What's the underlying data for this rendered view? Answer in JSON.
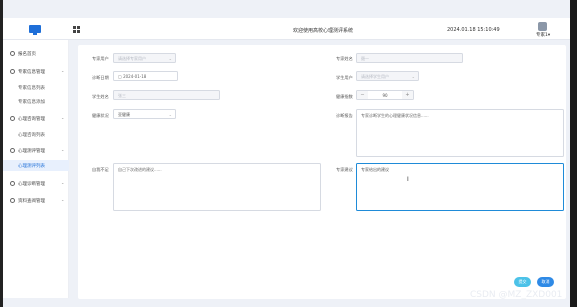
{
  "header": {
    "app_title": "欢迎使用高校心理测评系统",
    "datetime": "2024.01.18 15:10:49",
    "username": "专家1"
  },
  "sidebar": {
    "items": [
      {
        "label": "报名首页",
        "icon": "dashboard-icon"
      },
      {
        "label": "专家信息管理",
        "icon": "user-icon",
        "expandable": true
      },
      {
        "label": "专家信息列表",
        "sub": true
      },
      {
        "label": "专家信息添加",
        "sub": true
      },
      {
        "label": "心理咨询管理",
        "icon": "chat-icon",
        "expandable": true
      },
      {
        "label": "心理咨询列表",
        "sub": true
      },
      {
        "label": "心理测评管理",
        "icon": "test-icon",
        "expandable": true
      },
      {
        "label": "心理测评列表",
        "sub": true,
        "active": true
      },
      {
        "label": "心理诊断管理",
        "icon": "diagnose-icon",
        "expandable": true
      },
      {
        "label": "资料查阅管理",
        "icon": "book-icon",
        "expandable": true
      }
    ]
  },
  "form": {
    "expert_user_label": "专家用户",
    "expert_user_placeholder": "请选择专家用户",
    "expert_name_label": "专家姓名",
    "expert_name_value": "聂一",
    "eval_date_label": "诊断日期",
    "eval_date_value": "2024-01-18",
    "student_user_label": "学生用户",
    "student_user_placeholder": "请选择学生用户",
    "student_name_label": "学生姓名",
    "student_name_value": "张三",
    "health_score_label": "健康指数",
    "health_score_value": "90",
    "health_status_label": "健康状况",
    "health_status_value": "亚健康",
    "eval_report_label": "诊断报告",
    "eval_report_value": "专家诊断学生的心理健康状况信息......",
    "self_shortcoming_label": "自我不足",
    "self_shortcoming_value": "自己下次改进的建议......",
    "expert_advice_label": "专家建议",
    "expert_advice_value": "专家给出的建议"
  },
  "buttons": {
    "submit": "提交",
    "cancel": "取消"
  },
  "watermark": "CSDN @MZ_ZXD001",
  "colors": {
    "accent": "#1f6fd8",
    "submit": "#4cc2e8",
    "cancel": "#2f8ae6"
  }
}
